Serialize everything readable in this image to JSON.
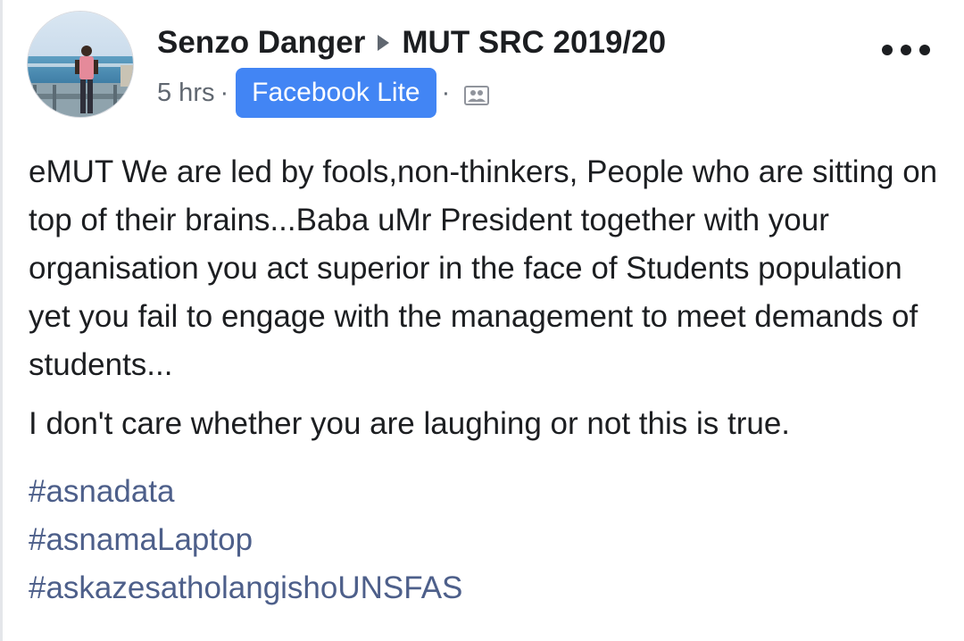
{
  "post": {
    "author": "Senzo Danger",
    "group": "MUT SRC 2019/20",
    "time": "5 hrs",
    "separator": "·",
    "app": "Facebook Lite",
    "paragraphs": [
      "eMUT We are led by fools,non-thinkers, People who are sitting on top of their brains...Baba uMr President together with your organisation you act superior in the face of Students population yet you fail to engage with the management to meet demands of students...",
      "I don't care whether you are laughing or not this is true."
    ],
    "hashtags": [
      "#asnadata",
      "#asnamaLaptop",
      "#askazesatholangishoUNSFAS"
    ]
  },
  "icons": {
    "arrow": "right-triangle-icon",
    "more": "more-options-icon",
    "audience": "group-audience-icon"
  },
  "colors": {
    "badge": "#4285f4",
    "hashtag": "#4d5f8a",
    "text": "#1c1e21",
    "meta": "#606770"
  }
}
